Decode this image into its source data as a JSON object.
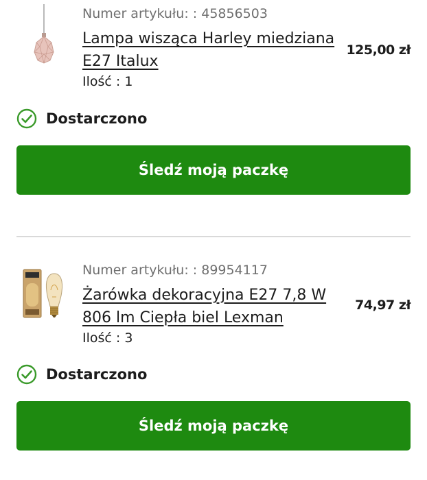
{
  "orders": [
    {
      "article_label": "Numer artykułu: : 45856503",
      "name": "Lampa wisząca Harley miedziana E27 Italux",
      "quantity": "Ilość : 1",
      "price": "125,00 zł",
      "status": "Dostarczono",
      "track_label": "Śledź moją paczkę",
      "image_icon": "pendant-lamp-image"
    },
    {
      "article_label": "Numer artykułu: : 89954117",
      "name": "Żarówka dekoracyjna E27 7,8 W 806 lm Ciepła biel Lexman",
      "quantity": "Ilość : 3",
      "price": "74,97 zł",
      "status": "Dostarczono",
      "track_label": "Śledź moją paczkę",
      "image_icon": "light-bulb-image"
    }
  ],
  "colors": {
    "accent_green": "#1e8a10",
    "status_icon_green": "#3a9a2a",
    "text_primary": "#1c1c1c",
    "text_secondary": "#6f6f6f",
    "divider": "#d9d9d9"
  }
}
